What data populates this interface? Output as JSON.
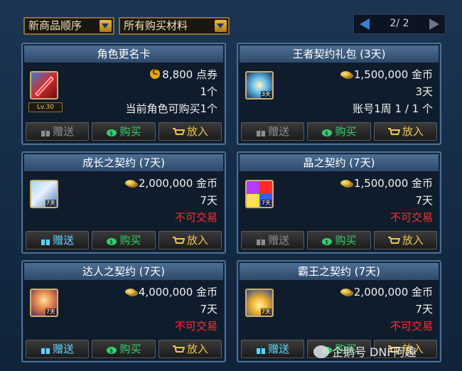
{
  "toolbar": {
    "sort_label": "新商品顺序",
    "filter_label": "所有购买材料",
    "page_indicator": "2/ 2"
  },
  "buttons": {
    "gift": "赠送",
    "buy": "购买",
    "cart": "放入"
  },
  "cards": [
    {
      "title": "角色更名卡",
      "icon": "rename-card-icon",
      "level_badge": "Lv.30",
      "price": "8,800 点券",
      "line2": "1个",
      "line3": "当前角色可购买1个",
      "gift_enabled": false
    },
    {
      "title": "王者契约礼包 (3天)",
      "icon": "king-contract-pack-icon",
      "thumb_days": "3天",
      "price": "1,500,000 金币",
      "line2": "3天",
      "line3": "账号1周 1 / 1 个",
      "gift_enabled": false
    },
    {
      "title": "成长之契约 (7天)",
      "icon": "growth-contract-icon",
      "thumb_days": "7天",
      "price": "2,000,000 金币",
      "line2": "7天",
      "line3": "不可交易",
      "gift_enabled": true
    },
    {
      "title": "晶之契约 (7天)",
      "icon": "crystal-contract-icon",
      "thumb_days": "7天",
      "price": "1,500,000 金币",
      "line2": "7天",
      "line3": "不可交易",
      "gift_enabled": false
    },
    {
      "title": "达人之契约 (7天)",
      "icon": "master-contract-icon",
      "thumb_days": "7天",
      "price": "4,000,000 金币",
      "line2": "7天",
      "line3": "不可交易",
      "gift_enabled": true
    },
    {
      "title": "霸王之契约 (7天)",
      "icon": "overlord-contract-icon",
      "thumb_days": "7天",
      "price": "2,000,000 金币",
      "line2": "7天",
      "line3": "不可交易",
      "gift_enabled": true
    }
  ],
  "watermark": "企鹅号 DNF阿趣",
  "colors": {
    "accent_gold": "#f1c44c",
    "buy_green": "#34d16a",
    "untradeable_red": "#ff3030",
    "gift_blue": "#5fd3ff"
  }
}
